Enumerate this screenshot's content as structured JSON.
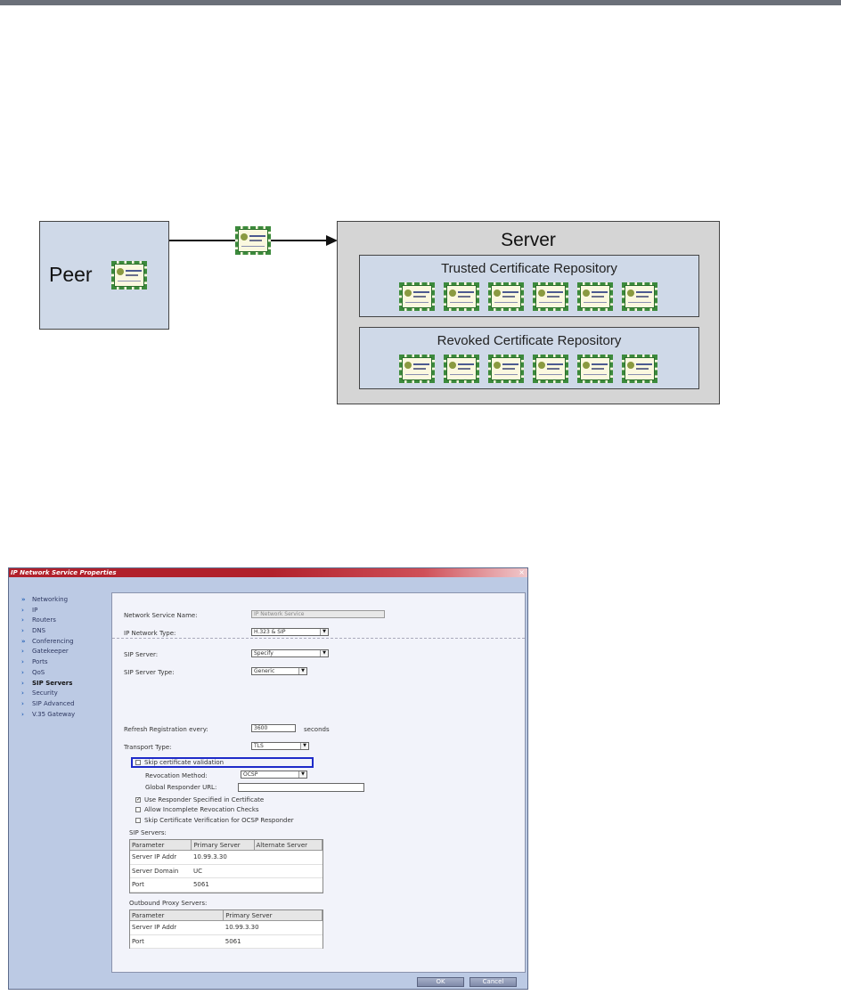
{
  "diagram": {
    "peer_label": "Peer",
    "server_label": "Server",
    "trusted_repo_title": "Trusted Certificate Repository",
    "revoked_repo_title": "Revoked Certificate Repository",
    "certificates_per_repository": 6,
    "colors": {
      "box_fill": "#cfd9e8",
      "server_fill": "#d5d5d5",
      "certificate_border": "#3c8a3c"
    }
  },
  "dialog": {
    "title": "IP Network Service Properties",
    "close_glyph": "×",
    "nav_items": [
      {
        "label": "Networking",
        "glyph": "»"
      },
      {
        "label": "IP",
        "glyph": "›"
      },
      {
        "label": "Routers",
        "glyph": "›"
      },
      {
        "label": "DNS",
        "glyph": "›"
      },
      {
        "label": "Conferencing",
        "glyph": "»"
      },
      {
        "label": "Gatekeeper",
        "glyph": "›"
      },
      {
        "label": "Ports",
        "glyph": "›"
      },
      {
        "label": "QoS",
        "glyph": "›"
      },
      {
        "label": "SIP Servers",
        "glyph": "›",
        "active": true
      },
      {
        "label": "Security",
        "glyph": "›"
      },
      {
        "label": "SIP Advanced",
        "glyph": "›"
      },
      {
        "label": "V.35 Gateway",
        "glyph": "›"
      }
    ],
    "fields": {
      "service_name_label": "Network Service Name:",
      "service_name_value": "IP Network Service",
      "network_type_label": "IP Network Type:",
      "network_type_value": "H.323 & SIP",
      "sip_server_label": "SIP Server:",
      "sip_server_value": "Specify",
      "sip_server_type_label": "SIP Server Type:",
      "sip_server_type_value": "Generic",
      "refresh_label": "Refresh Registration every:",
      "refresh_value": "3600",
      "refresh_unit": "seconds",
      "transport_label": "Transport Type:",
      "transport_value": "TLS",
      "skip_validation_label": "Skip certificate validation",
      "skip_validation_checked": false,
      "revocation_label": "Revocation Method:",
      "revocation_value": "OCSP",
      "global_responder_label": "Global Responder URL:",
      "global_responder_value": "",
      "use_responder_label": "Use Responder Specified in Certificate",
      "use_responder_checked": true,
      "allow_incomplete_label": "Allow Incomplete Revocation Checks",
      "allow_incomplete_checked": false,
      "skip_ocsp_label": "Skip Certificate Verification for OCSP Responder",
      "skip_ocsp_checked": false,
      "dropdown_glyph": "▼",
      "check_glyph": "✓"
    },
    "sip_servers": {
      "label": "SIP Servers:",
      "headers": [
        "Parameter",
        "Primary Server",
        "Alternate Server"
      ],
      "rows": [
        [
          "Server IP Addr",
          "10.99.3.30",
          ""
        ],
        [
          "Server Domain",
          "UC",
          ""
        ],
        [
          "Port",
          "5061",
          ""
        ]
      ]
    },
    "outbound_proxy": {
      "label": "Outbound Proxy Servers:",
      "headers": [
        "Parameter",
        "Primary Server"
      ],
      "rows": [
        [
          "Server IP Addr",
          "10.99.3.30"
        ],
        [
          "Port",
          "5061"
        ]
      ]
    },
    "buttons": {
      "ok": "OK",
      "cancel": "Cancel"
    },
    "colors": {
      "title_bar": "#b1202b",
      "dialog_bg": "#bccae4",
      "highlight_border": "#1e2bc9"
    }
  }
}
